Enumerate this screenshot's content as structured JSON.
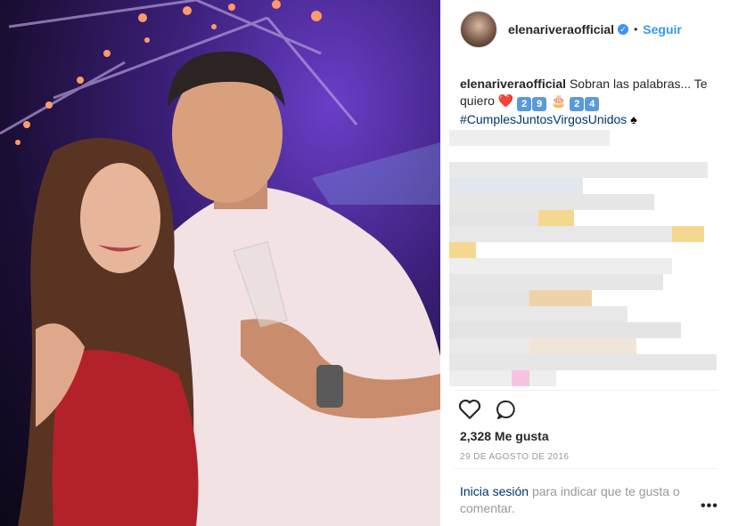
{
  "post": {
    "username": "elenariveraofficial",
    "separator": "•",
    "follow_label": "Seguir",
    "caption_text": "Sobran las palabras... Te quiero",
    "caption_emoji_heart": "❤️",
    "caption_digits_a": [
      "2",
      "9"
    ],
    "caption_emoji_cake": "🎂",
    "caption_digits_b": [
      "2",
      "4"
    ],
    "hashtag": "#CumplesJuntosVirgosUnidos",
    "hashtag_emoji": "♠",
    "likes": "2,328 Me gusta",
    "date": "29 DE AGOSTO DE 2016",
    "login_link": "Inicia sesión",
    "login_text": "para indicar que te gusta o comentar.",
    "more_label": "•••"
  },
  "icons": {
    "heart": "heart-icon",
    "comment": "comment-icon",
    "verified": "verified-badge-icon"
  },
  "colors": {
    "accent": "#3897f0",
    "link": "#003569",
    "muted": "#999999"
  }
}
